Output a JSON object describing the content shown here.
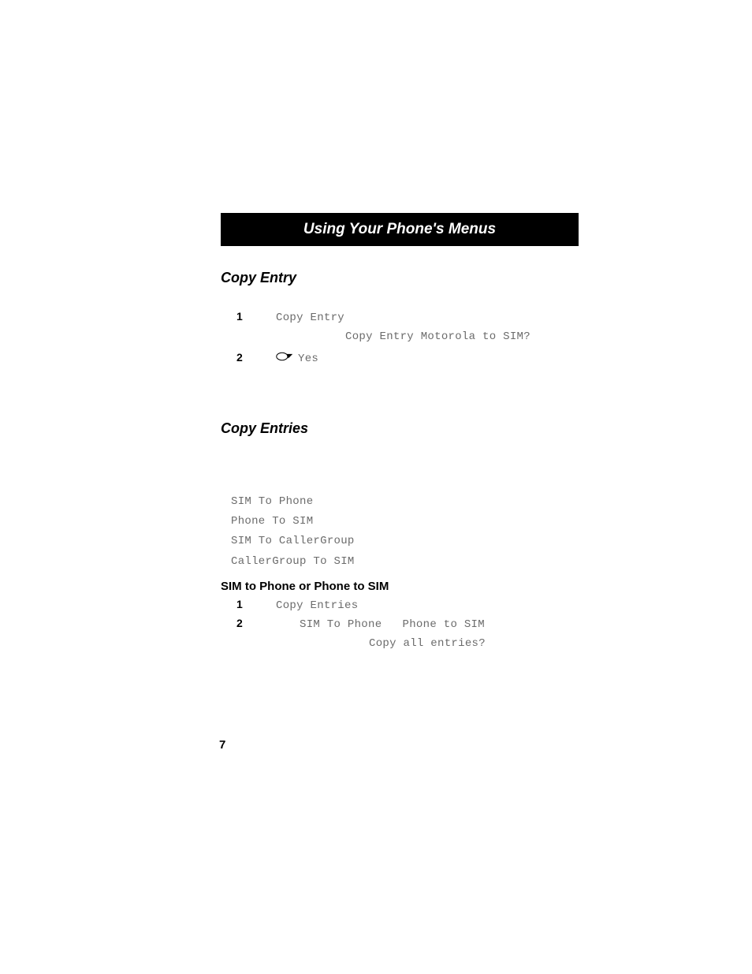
{
  "header": {
    "title": "Using Your Phone's Menus"
  },
  "section1": {
    "heading": "Copy Entry",
    "steps": [
      {
        "num": "1",
        "text": "Copy Entry"
      },
      {
        "num": "2",
        "text": "Yes"
      }
    ],
    "prompt": "Copy Entry Motorola to SIM?"
  },
  "section2": {
    "heading": "Copy Entries",
    "options": [
      "SIM To Phone",
      "Phone To SIM",
      "SIM To CallerGroup",
      "CallerGroup To SIM"
    ],
    "subheading": "SIM to Phone or Phone to SIM",
    "steps": [
      {
        "num": "1",
        "text": "Copy Entries"
      },
      {
        "num": "2",
        "opt1": "SIM To Phone",
        "opt2": "Phone to SIM"
      }
    ],
    "prompt": "Copy all entries?"
  },
  "pageNumber": "7"
}
